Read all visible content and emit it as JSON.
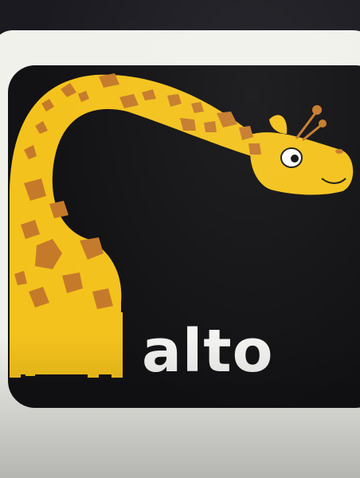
{
  "book_page": {
    "word": "alto",
    "illustration": "giraffe",
    "colors": {
      "background": "#1c1b22",
      "card": "#f1f1ec",
      "panel": "#121114",
      "giraffe_body": "#f4c21c",
      "giraffe_spots": "#c57a2a",
      "text": "#f4f4f2"
    }
  }
}
